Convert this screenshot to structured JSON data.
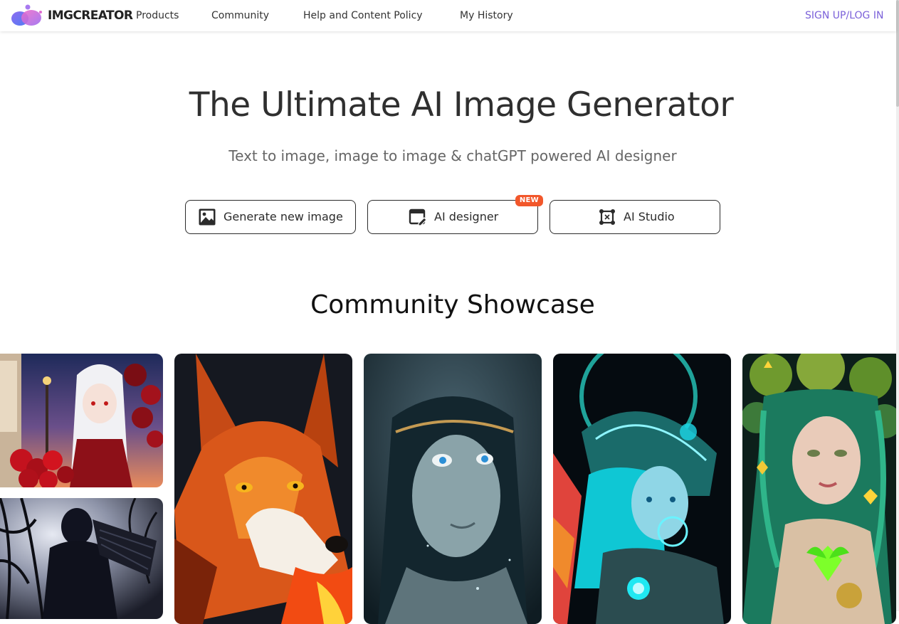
{
  "header": {
    "brand": "IMGCREATOR",
    "nav": {
      "products": "Products",
      "community": "Community",
      "help": "Help and Content Policy",
      "history": "My History"
    },
    "auth": {
      "signup": "SIGN UP",
      "separator": "/",
      "login": "LOG IN"
    }
  },
  "hero": {
    "title": "The Ultimate AI Image Generator",
    "subtitle": "Text to image, image to image & chatGPT powered AI designer",
    "buttons": {
      "generate": "Generate new image",
      "designer": "AI designer",
      "designer_badge": "NEW",
      "studio": "AI Studio"
    }
  },
  "showcase": {
    "title": "Community Showcase",
    "images": [
      "anime-girl-with-roses",
      "dark-figure-in-branches",
      "fire-fox",
      "underwater-girl-with-crown",
      "neon-cyberpunk-girl",
      "green-haired-nature-girl-with-butterflies"
    ]
  },
  "colors": {
    "accent": "#7b61d9",
    "badge": "#f2572b",
    "text": "#333333",
    "button_border": "#2b2b2b"
  },
  "icons": [
    "logo-icon",
    "image-icon",
    "edit-canvas-icon",
    "studio-crop-icon"
  ]
}
